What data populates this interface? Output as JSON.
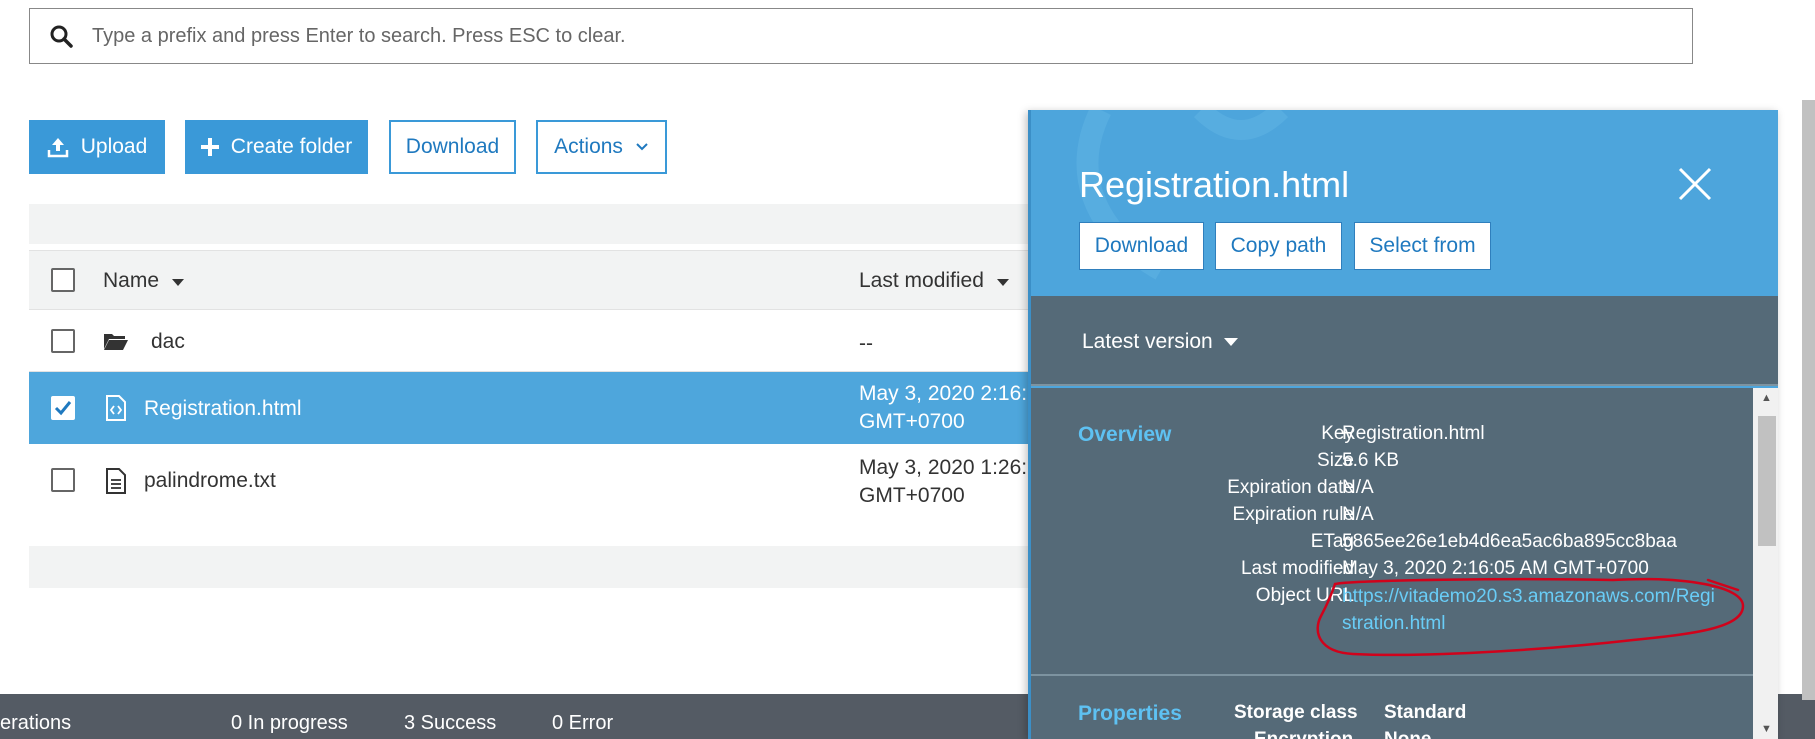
{
  "search": {
    "placeholder": "Type a prefix and press Enter to search. Press ESC to clear."
  },
  "toolbar": {
    "upload_label": "Upload",
    "create_folder_label": "Create folder",
    "download_label": "Download",
    "actions_label": "Actions"
  },
  "table": {
    "columns": [
      "Name",
      "Last modified"
    ],
    "rows": [
      {
        "name": "dac",
        "type": "folder",
        "last_modified_1": "--",
        "last_modified_2": "",
        "selected": false
      },
      {
        "name": "Registration.html",
        "type": "html",
        "last_modified_1": "May 3, 2020 2:16:",
        "last_modified_2": "GMT+0700",
        "selected": true
      },
      {
        "name": "palindrome.txt",
        "type": "text",
        "last_modified_1": "May 3, 2020 1:26:",
        "last_modified_2": "GMT+0700",
        "selected": false
      }
    ]
  },
  "footer": {
    "operations_label": "erations",
    "in_progress": "0 In progress",
    "success": "3 Success",
    "error": "0 Error"
  },
  "panel": {
    "title": "Registration.html",
    "buttons": [
      "Download",
      "Copy path",
      "Select from"
    ],
    "version_label": "Latest version",
    "overview": {
      "title": "Overview",
      "fields": [
        {
          "key": "Key",
          "value": "Registration.html"
        },
        {
          "key": "Size",
          "value": "5.6 KB"
        },
        {
          "key": "Expiration date",
          "value": "N/A"
        },
        {
          "key": "Expiration rule",
          "value": "N/A"
        },
        {
          "key": "ETag",
          "value": "5865ee26e1eb4d6ea5ac6ba895cc8baa"
        },
        {
          "key": "Last modified",
          "value": "May 3, 2020 2:16:05 AM GMT+0700"
        }
      ],
      "object_url_label": "Object URL",
      "object_url": "https://vitademo20.s3.amazonaws.com/Registration.html"
    },
    "properties": {
      "title": "Properties",
      "storage_class_label": "Storage class",
      "storage_class_value": "Standard",
      "encryption_label": "Encryption",
      "encryption_value": "None"
    }
  },
  "colors": {
    "accent": "#3a99d8",
    "panel": "#4da5dc",
    "panel_dark": "#556a78",
    "link": "#69cdf7",
    "annotation": "#d0021b"
  },
  "icons": [
    "search-icon",
    "upload-icon",
    "plus-icon",
    "chevron-down-icon",
    "folder-icon",
    "html-file-icon",
    "text-file-icon",
    "close-icon",
    "caret-down-icon",
    "checkmark-icon"
  ]
}
